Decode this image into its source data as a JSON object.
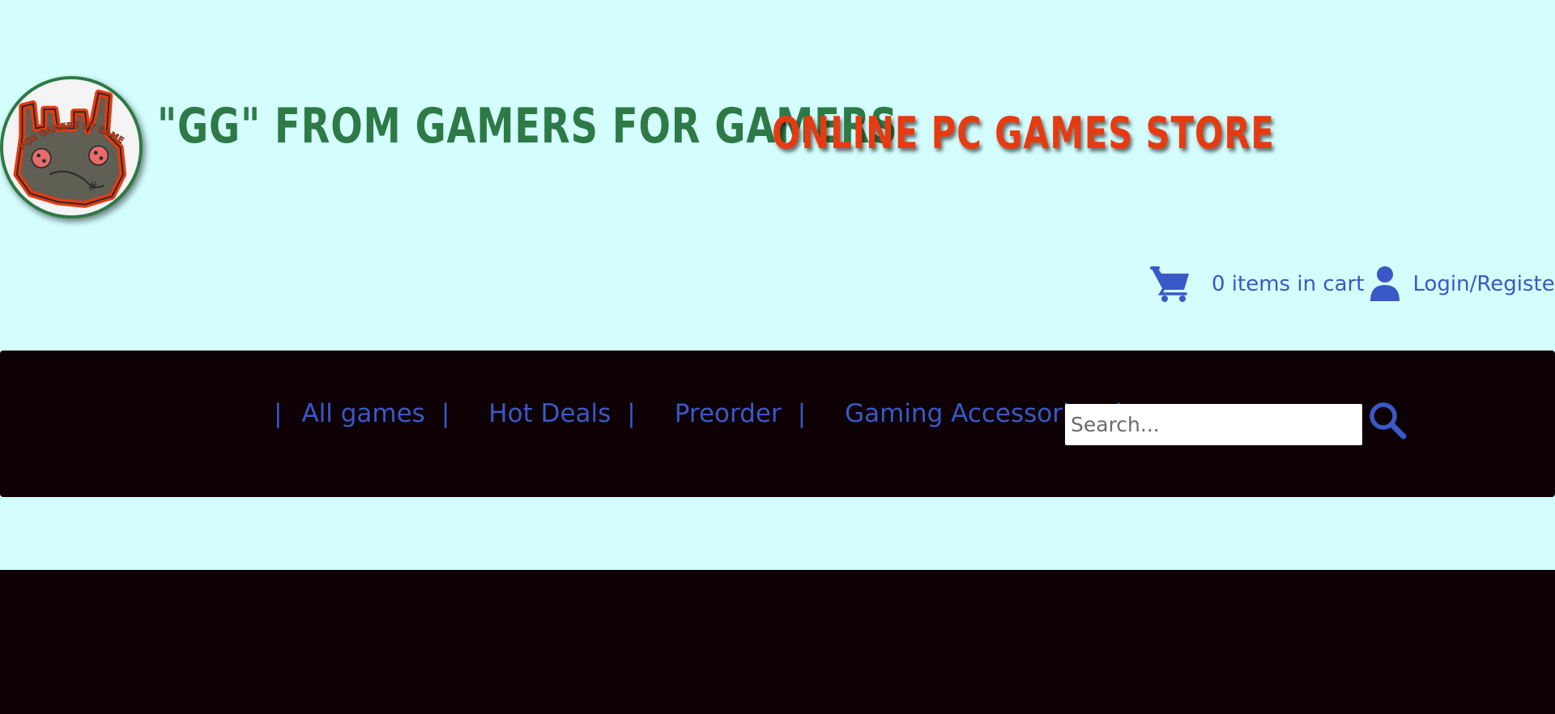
{
  "brand": {
    "title_green": "\"GG\" FROM GAMERS FOR GAMERS",
    "title_red": "ONLINE PC GAMES STORE",
    "logo_text": "FOR GAMERS BY GAMERS",
    "colors": {
      "green": "#2d7a46",
      "red": "#e83a10"
    }
  },
  "userbar": {
    "cart_icon": "shopping-cart-icon",
    "cart_text": "0 items in cart",
    "user_icon": "user-icon",
    "login_text": "Login/Register"
  },
  "nav": {
    "separator": "|",
    "items": [
      {
        "label": "All games"
      },
      {
        "label": "Hot Deals"
      },
      {
        "label": "Preorder"
      },
      {
        "label": "Gaming Accessories"
      }
    ],
    "search": {
      "placeholder": "Search...",
      "value": ""
    },
    "search_icon": "search-icon"
  },
  "colors": {
    "background": "#d4fefe",
    "dark_band": "#0e0105",
    "link": "#3a58c6"
  }
}
